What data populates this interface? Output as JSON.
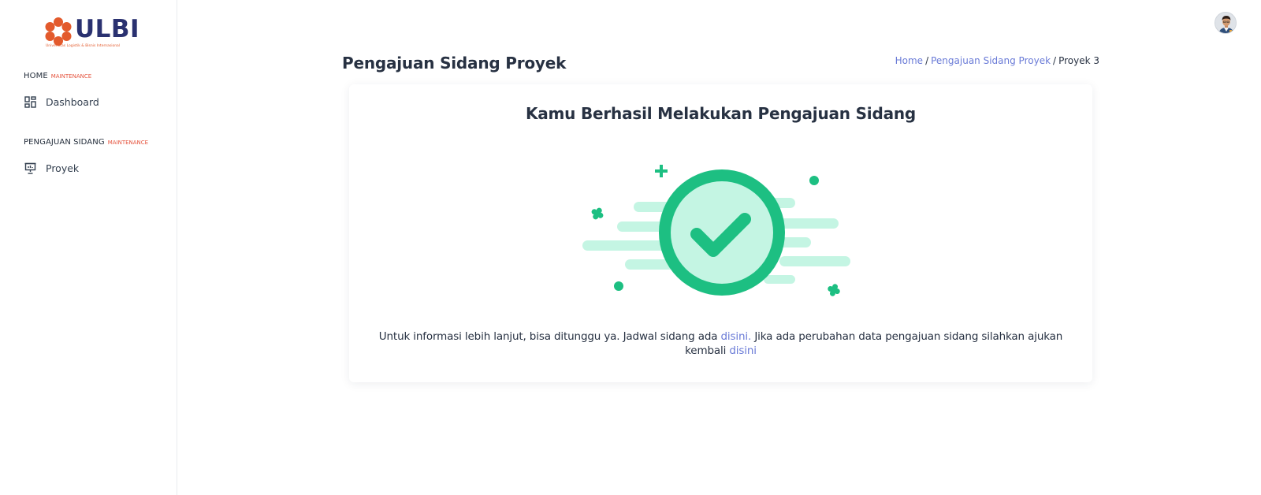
{
  "app": {
    "logo_text": "ULBI",
    "logo_subtitle": "Universitas Logistik & Bisnis Internasional"
  },
  "sidebar": {
    "sections": [
      {
        "title": "HOME",
        "badge": "MAINTENANCE",
        "items": [
          {
            "label": "Dashboard",
            "icon": "dashboard-icon"
          }
        ]
      },
      {
        "title": "PENGAJUAN SIDANG",
        "badge": "MAINTENANCE",
        "items": [
          {
            "label": "Proyek",
            "icon": "presentation-icon"
          }
        ]
      }
    ]
  },
  "header": {
    "avatar": "user-avatar"
  },
  "page": {
    "title": "Pengajuan Sidang Proyek",
    "breadcrumb": [
      {
        "label": "Home",
        "link": true
      },
      {
        "label": "Pengajuan Sidang Proyek",
        "link": true
      },
      {
        "label": "Proyek 3",
        "link": false
      }
    ],
    "separator": "/"
  },
  "card": {
    "title": "Kamu Berhasil Melakukan Pengajuan Sidang",
    "illustration": "success-check-icon",
    "text_part1": "Untuk informasi lebih lanjut, bisa ditunggu ya. Jadwal sidang ada ",
    "link1": "disini.",
    "text_part2": " Jika ada perubahan data pengajuan sidang silahkan ajukan kembali ",
    "link2": "disini"
  },
  "colors": {
    "brand_navy": "#2a3170",
    "brand_orange": "#e35a2c",
    "link": "#6a7bd7",
    "success_green": "#1dbf82",
    "success_light": "#c4f5e3",
    "maintenance_red": "#e5533d"
  }
}
